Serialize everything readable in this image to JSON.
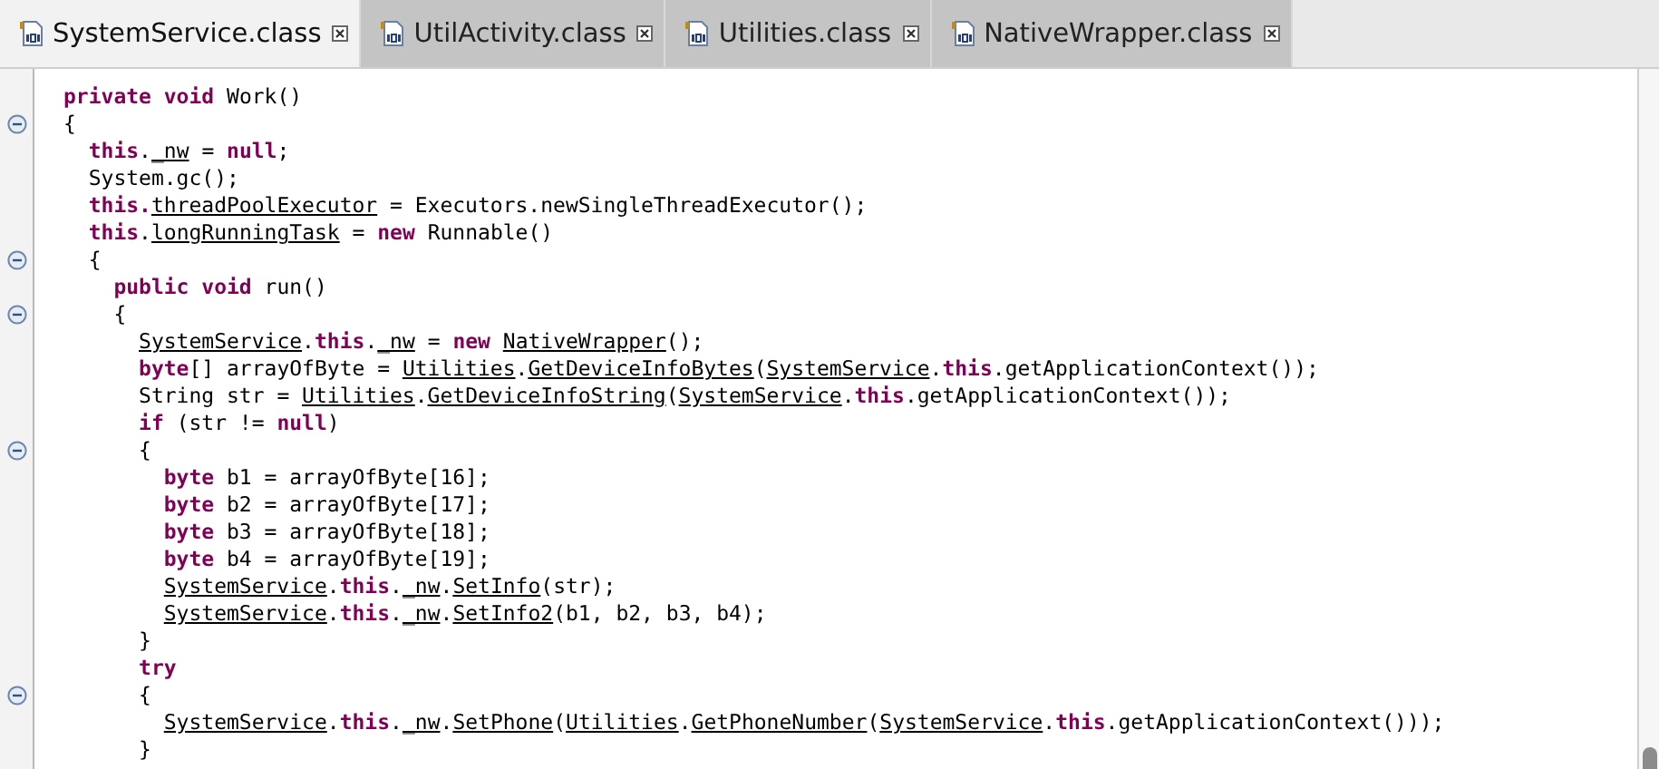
{
  "tabs": [
    {
      "label": "SystemService.class",
      "selected": true
    },
    {
      "label": "UtilActivity.class",
      "selected": false
    },
    {
      "label": "Utilities.class",
      "selected": false
    },
    {
      "label": "NativeWrapper.class",
      "selected": false
    }
  ],
  "editor": {
    "lines": [
      {
        "fold": false,
        "tokens": [
          {
            "kind": "keyword",
            "text": "private void"
          },
          {
            "kind": "plain",
            "text": " Work()"
          }
        ]
      },
      {
        "fold": true,
        "tokens": [
          {
            "kind": "plain",
            "text": "{"
          }
        ],
        "children": [
          {
            "fold": false,
            "tokens": [
              {
                "kind": "keyword",
                "text": "this"
              },
              {
                "kind": "plain",
                "text": "."
              },
              {
                "kind": "link",
                "text": "_nw"
              },
              {
                "kind": "plain",
                "text": " = "
              },
              {
                "kind": "keyword",
                "text": "null"
              },
              {
                "kind": "plain",
                "text": ";"
              }
            ]
          },
          {
            "fold": false,
            "tokens": [
              {
                "kind": "plain",
                "text": "System.gc();"
              }
            ]
          },
          {
            "fold": false,
            "tokens": [
              {
                "kind": "keyword",
                "text": "this."
              },
              {
                "kind": "link",
                "text": "threadPoolExecutor"
              },
              {
                "kind": "plain",
                "text": " = Executors.newSingleThreadExecutor();"
              }
            ]
          },
          {
            "fold": false,
            "tokens": [
              {
                "kind": "keyword",
                "text": "this"
              },
              {
                "kind": "plain",
                "text": "."
              },
              {
                "kind": "link",
                "text": "longRunningTask"
              },
              {
                "kind": "plain",
                "text": " = "
              },
              {
                "kind": "keyword",
                "text": "new"
              },
              {
                "kind": "plain",
                "text": " Runnable()"
              }
            ]
          },
          {
            "fold": true,
            "tokens": [
              {
                "kind": "plain",
                "text": "{"
              }
            ],
            "children": [
              {
                "fold": false,
                "tokens": [
                  {
                    "kind": "keyword",
                    "text": "public void"
                  },
                  {
                    "kind": "plain",
                    "text": " run()"
                  }
                ]
              },
              {
                "fold": true,
                "tokens": [
                  {
                    "kind": "plain",
                    "text": "{"
                  }
                ],
                "children": [
                  {
                    "fold": false,
                    "tokens": [
                      {
                        "kind": "link",
                        "text": "SystemService"
                      },
                      {
                        "kind": "plain",
                        "text": "."
                      },
                      {
                        "kind": "keyword",
                        "text": "this"
                      },
                      {
                        "kind": "plain",
                        "text": "."
                      },
                      {
                        "kind": "link",
                        "text": "_nw"
                      },
                      {
                        "kind": "plain",
                        "text": " = "
                      },
                      {
                        "kind": "keyword",
                        "text": "new "
                      },
                      {
                        "kind": "link",
                        "text": "NativeWrapper"
                      },
                      {
                        "kind": "plain",
                        "text": "();"
                      }
                    ]
                  },
                  {
                    "fold": false,
                    "tokens": [
                      {
                        "kind": "keyword",
                        "text": "byte"
                      },
                      {
                        "kind": "plain",
                        "text": "[] arrayOfByte = "
                      },
                      {
                        "kind": "link",
                        "text": "Utilities"
                      },
                      {
                        "kind": "plain",
                        "text": "."
                      },
                      {
                        "kind": "link",
                        "text": "GetDeviceInfoBytes"
                      },
                      {
                        "kind": "plain",
                        "text": "("
                      },
                      {
                        "kind": "link",
                        "text": "SystemService"
                      },
                      {
                        "kind": "plain",
                        "text": "."
                      },
                      {
                        "kind": "keyword",
                        "text": "this"
                      },
                      {
                        "kind": "plain",
                        "text": ".getApplicationContext());"
                      }
                    ]
                  },
                  {
                    "fold": false,
                    "tokens": [
                      {
                        "kind": "plain",
                        "text": "String str = "
                      },
                      {
                        "kind": "link",
                        "text": "Utilities"
                      },
                      {
                        "kind": "plain",
                        "text": "."
                      },
                      {
                        "kind": "link",
                        "text": "GetDeviceInfoString"
                      },
                      {
                        "kind": "plain",
                        "text": "("
                      },
                      {
                        "kind": "link",
                        "text": "SystemService"
                      },
                      {
                        "kind": "plain",
                        "text": "."
                      },
                      {
                        "kind": "keyword",
                        "text": "this"
                      },
                      {
                        "kind": "plain",
                        "text": ".getApplicationContext());"
                      }
                    ]
                  },
                  {
                    "fold": false,
                    "tokens": [
                      {
                        "kind": "keyword",
                        "text": "if"
                      },
                      {
                        "kind": "plain",
                        "text": " (str != "
                      },
                      {
                        "kind": "keyword",
                        "text": "null"
                      },
                      {
                        "kind": "plain",
                        "text": ")"
                      }
                    ]
                  },
                  {
                    "fold": true,
                    "tokens": [
                      {
                        "kind": "plain",
                        "text": "{"
                      }
                    ],
                    "children": [
                      {
                        "fold": false,
                        "tokens": [
                          {
                            "kind": "keyword",
                            "text": "byte"
                          },
                          {
                            "kind": "plain",
                            "text": " b1 = arrayOfByte[16];"
                          }
                        ]
                      },
                      {
                        "fold": false,
                        "tokens": [
                          {
                            "kind": "keyword",
                            "text": "byte"
                          },
                          {
                            "kind": "plain",
                            "text": " b2 = arrayOfByte[17];"
                          }
                        ]
                      },
                      {
                        "fold": false,
                        "tokens": [
                          {
                            "kind": "keyword",
                            "text": "byte"
                          },
                          {
                            "kind": "plain",
                            "text": " b3 = arrayOfByte[18];"
                          }
                        ]
                      },
                      {
                        "fold": false,
                        "tokens": [
                          {
                            "kind": "keyword",
                            "text": "byte"
                          },
                          {
                            "kind": "plain",
                            "text": " b4 = arrayOfByte[19];"
                          }
                        ]
                      },
                      {
                        "fold": false,
                        "tokens": [
                          {
                            "kind": "link",
                            "text": "SystemService"
                          },
                          {
                            "kind": "plain",
                            "text": "."
                          },
                          {
                            "kind": "keyword",
                            "text": "this"
                          },
                          {
                            "kind": "plain",
                            "text": "."
                          },
                          {
                            "kind": "link",
                            "text": "_nw"
                          },
                          {
                            "kind": "plain",
                            "text": "."
                          },
                          {
                            "kind": "link",
                            "text": "SetInfo"
                          },
                          {
                            "kind": "plain",
                            "text": "(str);"
                          }
                        ]
                      },
                      {
                        "fold": false,
                        "tokens": [
                          {
                            "kind": "link",
                            "text": "SystemService"
                          },
                          {
                            "kind": "plain",
                            "text": "."
                          },
                          {
                            "kind": "keyword",
                            "text": "this"
                          },
                          {
                            "kind": "plain",
                            "text": "."
                          },
                          {
                            "kind": "link",
                            "text": "_nw"
                          },
                          {
                            "kind": "plain",
                            "text": "."
                          },
                          {
                            "kind": "link",
                            "text": "SetInfo2"
                          },
                          {
                            "kind": "plain",
                            "text": "(b1, b2, b3, b4);"
                          }
                        ]
                      }
                    ]
                  },
                  {
                    "fold": false,
                    "tokens": [
                      {
                        "kind": "plain",
                        "text": "}"
                      }
                    ]
                  },
                  {
                    "fold": false,
                    "tokens": [
                      {
                        "kind": "keyword",
                        "text": "try"
                      }
                    ]
                  },
                  {
                    "fold": true,
                    "tokens": [
                      {
                        "kind": "plain",
                        "text": "{"
                      }
                    ],
                    "children": [
                      {
                        "fold": false,
                        "tokens": [
                          {
                            "kind": "link",
                            "text": "SystemService"
                          },
                          {
                            "kind": "plain",
                            "text": "."
                          },
                          {
                            "kind": "keyword",
                            "text": "this"
                          },
                          {
                            "kind": "plain",
                            "text": "."
                          },
                          {
                            "kind": "link",
                            "text": "_nw"
                          },
                          {
                            "kind": "plain",
                            "text": "."
                          },
                          {
                            "kind": "link",
                            "text": "SetPhone"
                          },
                          {
                            "kind": "plain",
                            "text": "("
                          },
                          {
                            "kind": "link",
                            "text": "Utilities"
                          },
                          {
                            "kind": "plain",
                            "text": "."
                          },
                          {
                            "kind": "link",
                            "text": "GetPhoneNumber"
                          },
                          {
                            "kind": "plain",
                            "text": "("
                          },
                          {
                            "kind": "link",
                            "text": "SystemService"
                          },
                          {
                            "kind": "plain",
                            "text": "."
                          },
                          {
                            "kind": "keyword",
                            "text": "this"
                          },
                          {
                            "kind": "plain",
                            "text": ".getApplicationContext()));"
                          }
                        ]
                      }
                    ]
                  },
                  {
                    "fold": false,
                    "tokens": [
                      {
                        "kind": "plain",
                        "text": "}"
                      }
                    ]
                  }
                ]
              }
            ]
          }
        ]
      }
    ]
  }
}
